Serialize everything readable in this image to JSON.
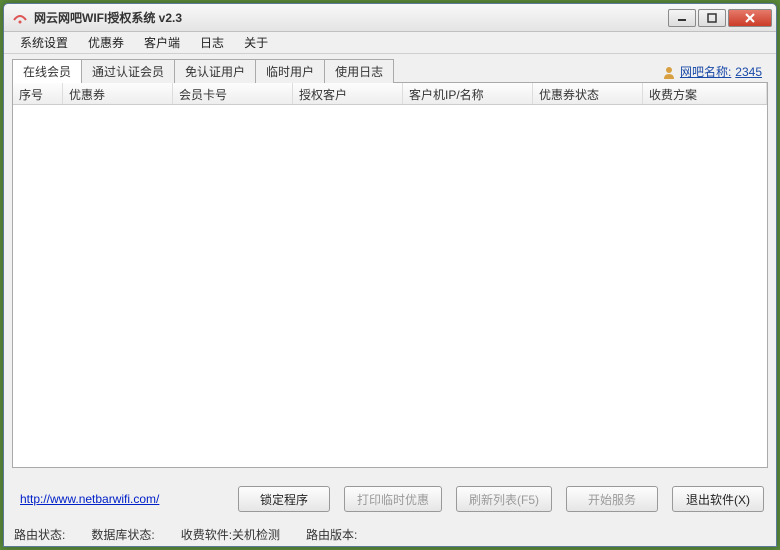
{
  "window": {
    "title": "网云网吧WIFI授权系统  v2.3"
  },
  "menu": {
    "items": [
      "系统设置",
      "优惠券",
      "客户端",
      "日志",
      "关于"
    ]
  },
  "tabs": {
    "items": [
      "在线会员",
      "通过认证会员",
      "免认证用户",
      "临时用户",
      "使用日志"
    ],
    "active_index": 0
  },
  "topright": {
    "label": "网吧名称:",
    "value": "2345"
  },
  "table": {
    "columns": [
      "序号",
      "优惠券",
      "会员卡号",
      "授权客户",
      "客户机IP/名称",
      "优惠券状态",
      "收费方案"
    ],
    "rows": []
  },
  "footer": {
    "url": "http://www.netbarwifi.com/",
    "buttons": {
      "lock": "锁定程序",
      "print": "打印临时优惠",
      "refresh": "刷新列表(F5)",
      "start": "开始服务",
      "exit": "退出软件(X)"
    }
  },
  "status": {
    "route_state_label": "路由状态:",
    "db_state_label": "数据库状态:",
    "billing_label": "收费软件:",
    "billing_value": "关机检测",
    "route_ver_label": "路由版本:"
  }
}
